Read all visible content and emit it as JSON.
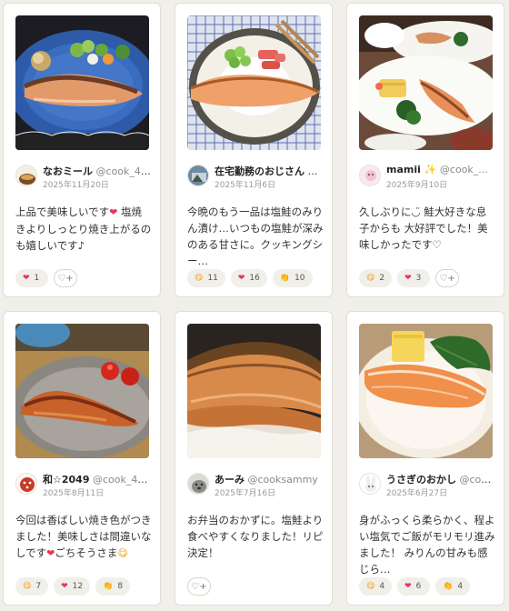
{
  "cards": [
    {
      "user": "なおミール",
      "handle": "@cook_401...",
      "date": "2025年11月20日",
      "comment_parts": [
        "上品で美味しいです",
        "❤",
        " 塩焼きよりしっとり焼き上がるのも嬉しいです♪"
      ],
      "reactions": [
        {
          "icon": "heart-icon",
          "glyph": "❤",
          "count": "1"
        }
      ],
      "add_reaction": true
    },
    {
      "user": "在宅勤務のおじさん",
      "handle": "@...",
      "date": "2025年11月6日",
      "comment_parts": [
        "今晩のもう一品は塩鮭のみりん漬け…いつもの塩鮭が深みのある甘さに。クッキングシー…"
      ],
      "reactions": [
        {
          "icon": "yum-face-icon",
          "glyph": "😋",
          "count": "11"
        },
        {
          "icon": "heart-icon",
          "glyph": "❤",
          "count": "16"
        },
        {
          "icon": "clap-icon",
          "glyph": "👏",
          "count": "10"
        }
      ],
      "add_reaction": false
    },
    {
      "user": "mamii ✨",
      "handle": "@cook_...",
      "date": "2025年9月10日",
      "comment_parts": [
        "久しぶりに◡̈ 鮭大好きな息子からも 大好評でした！美味しかったです♡"
      ],
      "reactions": [
        {
          "icon": "yum-face-icon",
          "glyph": "😋",
          "count": "2"
        },
        {
          "icon": "heart-icon",
          "glyph": "❤",
          "count": "3"
        }
      ],
      "add_reaction": true
    },
    {
      "user": "和☆2049",
      "handle": "@cook_40...",
      "date": "2025年8月11日",
      "comment_parts": [
        "今回は香ばしい焼き色がつきました！美味しさは間違いなしです",
        "❤",
        "ごちそうさま",
        "😋"
      ],
      "reactions": [
        {
          "icon": "yum-face-icon",
          "glyph": "😋",
          "count": "7"
        },
        {
          "icon": "heart-icon",
          "glyph": "❤",
          "count": "12"
        },
        {
          "icon": "clap-icon",
          "glyph": "👏",
          "count": "8"
        }
      ],
      "add_reaction": false
    },
    {
      "user": "あーみ",
      "handle": "@cooksammy",
      "date": "2025年7月16日",
      "comment_parts": [
        "お弁当のおかずに。塩鮭より食べやすくなりました！リピ決定！"
      ],
      "reactions": [],
      "add_reaction": true
    },
    {
      "user": "うさぎのおかし",
      "handle": "@cook_...",
      "date": "2025年6月27日",
      "comment_parts": [
        "身がふっくら柔らかく、程よい塩気でご飯がモリモリ進みました！ みりんの甘みも感じら…"
      ],
      "reactions": [
        {
          "icon": "yum-face-icon",
          "glyph": "😋",
          "count": "4"
        },
        {
          "icon": "heart-icon",
          "glyph": "❤",
          "count": "6"
        },
        {
          "icon": "clap-icon",
          "glyph": "👏",
          "count": "4"
        }
      ],
      "add_reaction": false
    }
  ],
  "add_reaction_glyph": "♡+",
  "colors": {
    "heart": "#e8355b",
    "pill_bg": "#f1efea",
    "card_border": "#e2ded6",
    "page_bg": "#f1efe9"
  }
}
